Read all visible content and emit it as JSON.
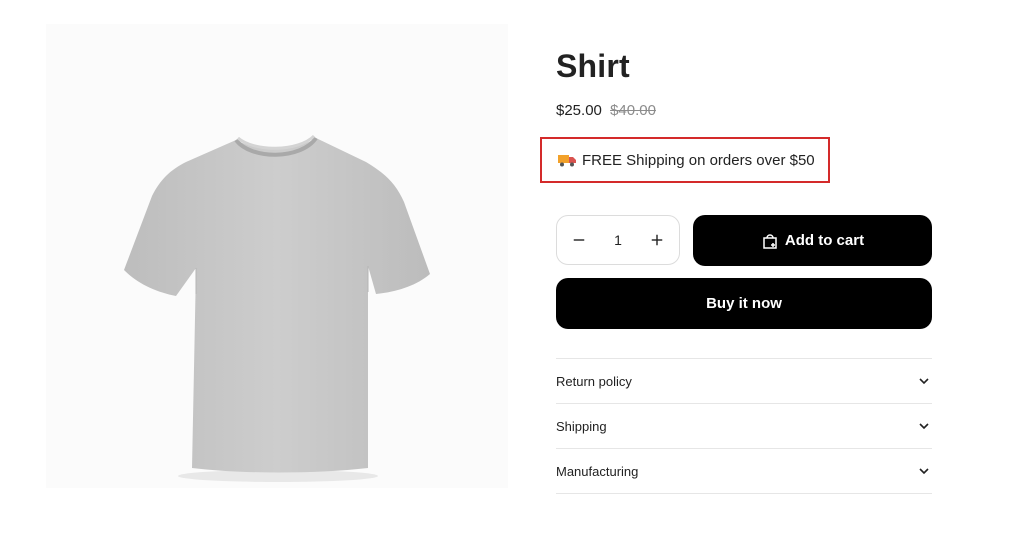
{
  "product": {
    "title": "Shirt",
    "price_sale": "$25.00",
    "price_compare": "$40.00",
    "shipping_notice": "FREE Shipping on orders over $50",
    "image_alt": "Grey t-shirt"
  },
  "quantity": {
    "value": "1"
  },
  "buttons": {
    "add_to_cart": "Add to cart",
    "buy_now": "Buy it now"
  },
  "accordion": {
    "items": [
      {
        "label": "Return policy"
      },
      {
        "label": "Shipping"
      },
      {
        "label": "Manufacturing"
      }
    ]
  },
  "colors": {
    "highlight_border": "#d42a2a",
    "button_bg": "#000000",
    "shirt": "#c9c9c9"
  },
  "icons": {
    "shipping": "truck-icon",
    "cart": "shopping-bag-icon",
    "decrease": "minus-icon",
    "increase": "plus-icon",
    "expand": "chevron-down-icon"
  }
}
